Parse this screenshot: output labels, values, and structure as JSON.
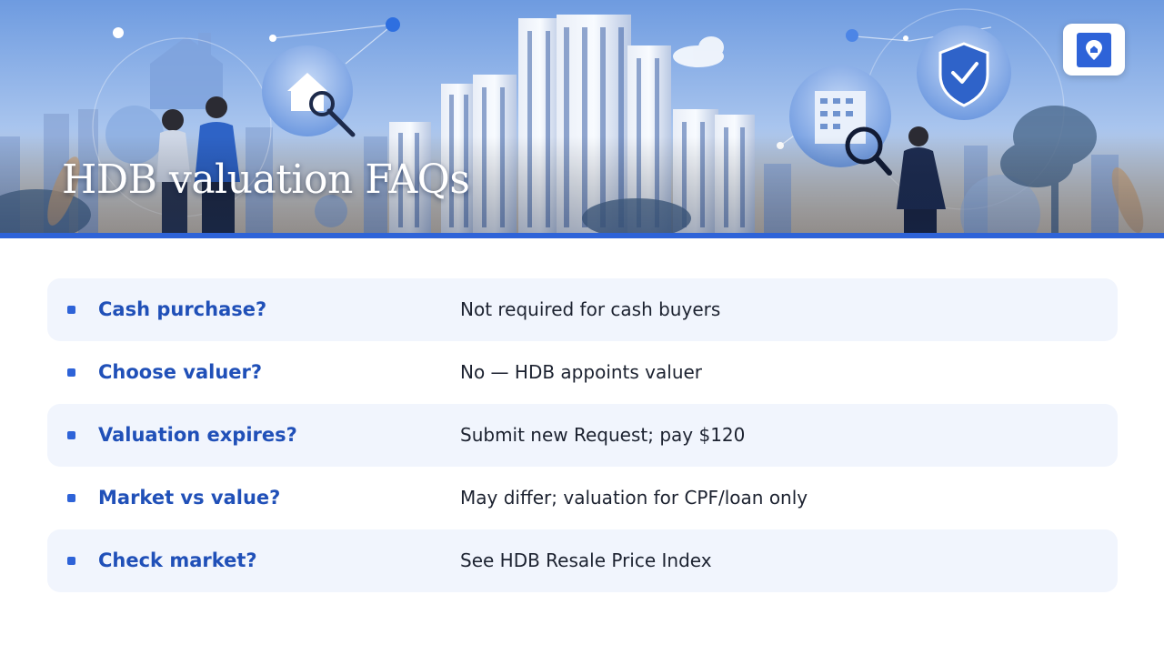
{
  "header": {
    "title": "HDB valuation FAQs"
  },
  "logo": {
    "icon": "house-pin-logo-icon"
  },
  "colors": {
    "accent": "#2e63d8",
    "question_text": "#2050b8",
    "row_shade": "#f1f5fd",
    "answer_text": "#1c2230"
  },
  "faqs": [
    {
      "question": "Cash purchase?",
      "answer": "Not required for cash buyers"
    },
    {
      "question": "Choose valuer?",
      "answer": "No — HDB appoints valuer"
    },
    {
      "question": "Valuation expires?",
      "answer": "Submit new Request; pay $120"
    },
    {
      "question": "Market vs value?",
      "answer": "May differ; valuation for CPF/loan only"
    },
    {
      "question": "Check market?",
      "answer": "See HDB Resale Price Index"
    }
  ]
}
